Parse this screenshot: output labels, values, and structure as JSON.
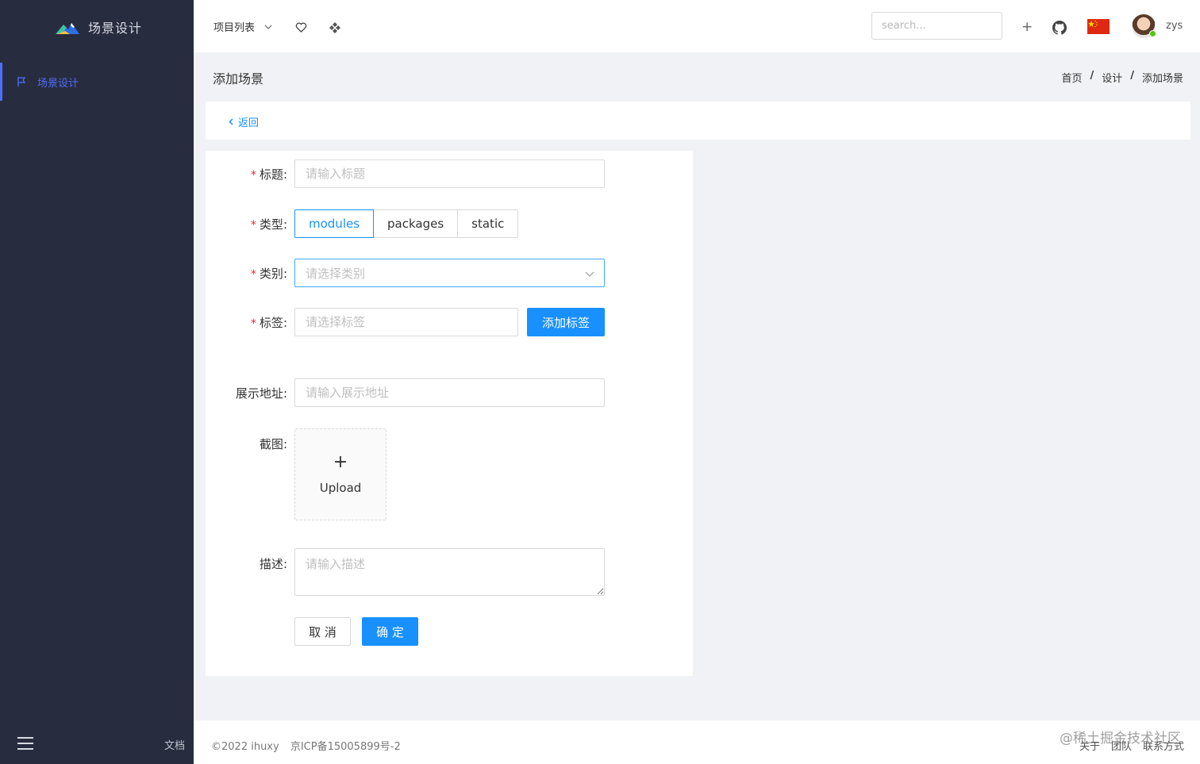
{
  "app": {
    "title": "场景设计"
  },
  "sidebar": {
    "items": [
      {
        "label": "场景设计",
        "icon": "flag-icon",
        "active": true
      }
    ],
    "docs_label": "文档"
  },
  "header": {
    "project_menu_label": "项目列表",
    "search_placeholder": "search...",
    "plus_label": "+",
    "username": "zys"
  },
  "page": {
    "title": "添加场景",
    "breadcrumb": [
      "首页",
      "设计",
      "添加场景"
    ],
    "back_label": "返回"
  },
  "form": {
    "title_label": "标题",
    "title_placeholder": "请输入标题",
    "type_label": "类型",
    "type_options": [
      "modules",
      "packages",
      "static"
    ],
    "type_selected": "modules",
    "category_label": "类别",
    "category_placeholder": "请选择类别",
    "tags_label": "标签",
    "tags_placeholder": "请选择标签",
    "add_tag_label": "添加标签",
    "url_label": "展示地址",
    "url_placeholder": "请输入展示地址",
    "screenshot_label": "截图",
    "upload_label": "Upload",
    "desc_label": "描述",
    "desc_placeholder": "请输入描述",
    "cancel_label": "取 消",
    "confirm_label": "确 定",
    "colon": ":",
    "required_mark": "*"
  },
  "footer": {
    "copyright": "©2022 ihuxy",
    "icp": "京ICP备15005899号-2",
    "links": [
      "关于",
      "团队",
      "联系方式"
    ],
    "watermark": "@稀土掘金技术社区"
  },
  "colors": {
    "sidebar_bg": "#282c3f",
    "primary": "#1890ff",
    "accent": "#4f6ef7",
    "required": "#f5222d"
  }
}
